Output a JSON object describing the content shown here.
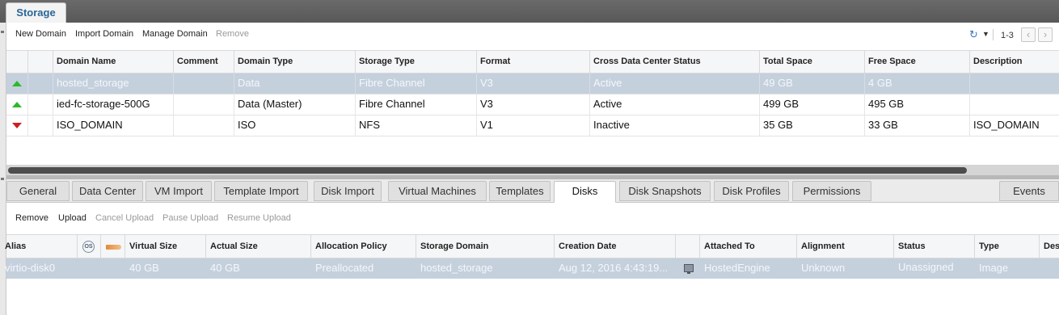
{
  "main_tab": {
    "label": "Storage"
  },
  "toolbar": {
    "new_domain": "New Domain",
    "import_domain": "Import Domain",
    "manage_domain": "Manage Domain",
    "remove": "Remove",
    "paging": "1-3"
  },
  "domain_grid": {
    "columns": [
      "Domain Name",
      "Comment",
      "Domain Type",
      "Storage Type",
      "Format",
      "Cross Data Center Status",
      "Total Space",
      "Free Space",
      "Description"
    ],
    "rows": [
      {
        "status": "up",
        "name": "hosted_storage",
        "comment": "",
        "type": "Data",
        "storage_type": "Fibre Channel",
        "format": "V3",
        "dc_status": "Active",
        "total": "49 GB",
        "free": "4 GB",
        "description": ""
      },
      {
        "status": "up",
        "name": "ied-fc-storage-500G",
        "comment": "",
        "type": "Data (Master)",
        "storage_type": "Fibre Channel",
        "format": "V3",
        "dc_status": "Active",
        "total": "499 GB",
        "free": "495 GB",
        "description": ""
      },
      {
        "status": "down",
        "name": "ISO_DOMAIN",
        "comment": "",
        "type": "ISO",
        "storage_type": "NFS",
        "format": "V1",
        "dc_status": "Inactive",
        "total": "35 GB",
        "free": "33 GB",
        "description": "ISO_DOMAIN"
      }
    ]
  },
  "subtabs": [
    "General",
    "Data Center",
    "VM Import",
    "Template Import",
    "Disk Import",
    "Virtual Machines",
    "Templates",
    "Disks",
    "Disk Snapshots",
    "Disk Profiles",
    "Permissions",
    "Events"
  ],
  "active_subtab": "Disks",
  "disk_toolbar": {
    "remove": "Remove",
    "upload": "Upload",
    "cancel_upload": "Cancel Upload",
    "pause_upload": "Pause Upload",
    "resume_upload": "Resume Upload"
  },
  "disk_grid": {
    "columns": {
      "alias": "Alias",
      "os_icon_text": "OS",
      "virtual_size": "Virtual Size",
      "actual_size": "Actual Size",
      "allocation_policy": "Allocation Policy",
      "storage_domain": "Storage Domain",
      "creation_date": "Creation Date",
      "attached_to": "Attached To",
      "alignment": "Alignment",
      "status": "Status",
      "type": "Type",
      "description": "Des"
    },
    "row": {
      "alias": "virtio-disk0",
      "virtual_size": "40 GB",
      "actual_size": "40 GB",
      "allocation_policy": "Preallocated",
      "storage_domain": "hosted_storage",
      "creation_date": "Aug 12, 2016 4:43:19...",
      "attached_to": "HostedEngine",
      "alignment": "Unknown",
      "status": "Unassigned",
      "type": "Image"
    }
  },
  "colors": {
    "accent": "#2a6597",
    "selected_row": "#c5d0dd",
    "status_up": "#2eb82e",
    "status_down": "#cc2020"
  }
}
